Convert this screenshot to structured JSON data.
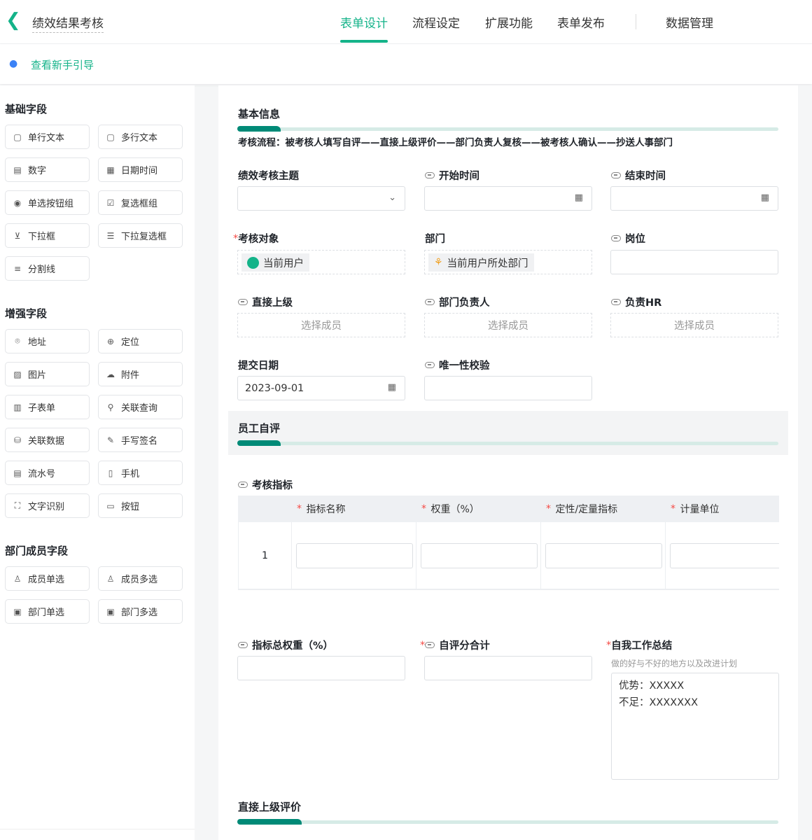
{
  "header": {
    "title": "绩效结果考核",
    "tabs": [
      "表单设计",
      "流程设定",
      "扩展功能",
      "表单发布",
      "数据管理"
    ],
    "active_tab": "表单设计"
  },
  "guide": {
    "label": "查看新手引导"
  },
  "sidebar": {
    "basic": {
      "title": "基础字段",
      "items": [
        "单行文本",
        "多行文本",
        "数字",
        "日期时间",
        "单选按钮组",
        "复选框组",
        "下拉框",
        "下拉复选框",
        "分割线"
      ]
    },
    "enhanced": {
      "title": "增强字段",
      "items": [
        "地址",
        "定位",
        "图片",
        "附件",
        "子表单",
        "关联查询",
        "关联数据",
        "手写签名",
        "流水号",
        "手机",
        "文字识别",
        "按钮"
      ]
    },
    "dept": {
      "title": "部门成员字段",
      "items": [
        "成员单选",
        "成员多选",
        "部门单选",
        "部门多选"
      ]
    }
  },
  "form": {
    "section1": "基本信息",
    "flow": "考核流程：被考核人填写自评——直接上级评价——部门负责人复核——被考核人确认——抄送人事部门",
    "fields": {
      "topic": "绩效考核主题",
      "start": "开始时间",
      "end": "结束时间",
      "target": "考核对象",
      "target_value": "当前用户",
      "dept": "部门",
      "dept_value": "当前用户所处部门",
      "post": "岗位",
      "leader": "直接上级",
      "dept_head": "部门负责人",
      "hr": "负责HR",
      "select_member": "选择成员",
      "submit_date": "提交日期",
      "submit_date_value": "2023-09-01",
      "unique": "唯一性校验"
    },
    "section2": "员工自评",
    "indicators": {
      "label": "考核指标",
      "columns": [
        "指标名称",
        "权重（%）",
        "定性/定量指标",
        "计量单位"
      ],
      "rows": [
        {
          "index": "1"
        }
      ]
    },
    "total_weight": "指标总权重（%）",
    "self_score": "自评分合计",
    "summary": {
      "label": "自我工作总结",
      "hint": "做的好与不好的地方以及改进计划",
      "line1": "优势：XXXXX",
      "line2": "不足：XXXXXXX"
    },
    "section3": "直接上级评价"
  },
  "colors": {
    "accent": "#14b389",
    "bar": "#008a77",
    "required": "#f54a45"
  }
}
